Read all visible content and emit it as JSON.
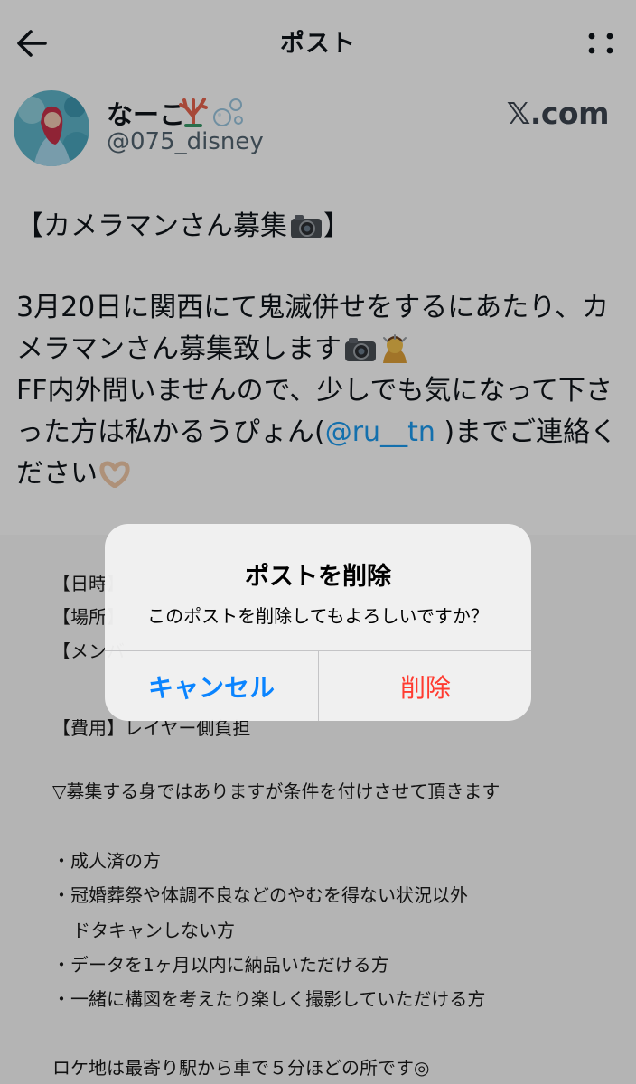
{
  "header": {
    "title": "ポスト",
    "back_icon": "arrow-left-icon",
    "more_icon": "more-vertical-icon"
  },
  "author": {
    "name": "なーこ",
    "name_emoji": [
      "coral-emoji",
      "bubbles-emoji"
    ],
    "handle": "@075_disney",
    "brand": "𝕏.com"
  },
  "post": {
    "heading": "【カメラマンさん募集",
    "heading_close": "】",
    "lines": [
      "3月20日に関西にて鬼滅併せをするにあたり、カ",
      "メラマンさん募集致します",
      "FF内外問いませんので、少しでも気になって下さ",
      "った方は私かるうぴょん(",
      "@ru__tn",
      " )までご連絡く",
      "ださい"
    ]
  },
  "image_text": {
    "l1": "【日時】",
    "l2": "【場所】",
    "l3": "【メンバ",
    "l4": "【費用】レイヤー側負担",
    "l5": "▽募集する身ではありますが条件を付けさせて頂きます",
    "l6": "・成人済の方",
    "l7": "・冠婚葬祭や体調不良などのやむを得ない状況以外",
    "l8": "ドタキャンしない方",
    "l9": "・データを1ヶ月以内に納品いただける方",
    "l10": "・一緒に構図を考えたり楽しく撮影していただける方",
    "l11": "ロケ地は最寄り駅から車で５分ほどの所です◎"
  },
  "dialog": {
    "title": "ポストを削除",
    "message": "このポストを削除してもよろしいですか？",
    "cancel_label": "キャンセル",
    "delete_label": "削除"
  },
  "colors": {
    "accent": "#1d9bf0",
    "ios_blue": "#0a84ff",
    "destructive": "#ff3b30"
  }
}
